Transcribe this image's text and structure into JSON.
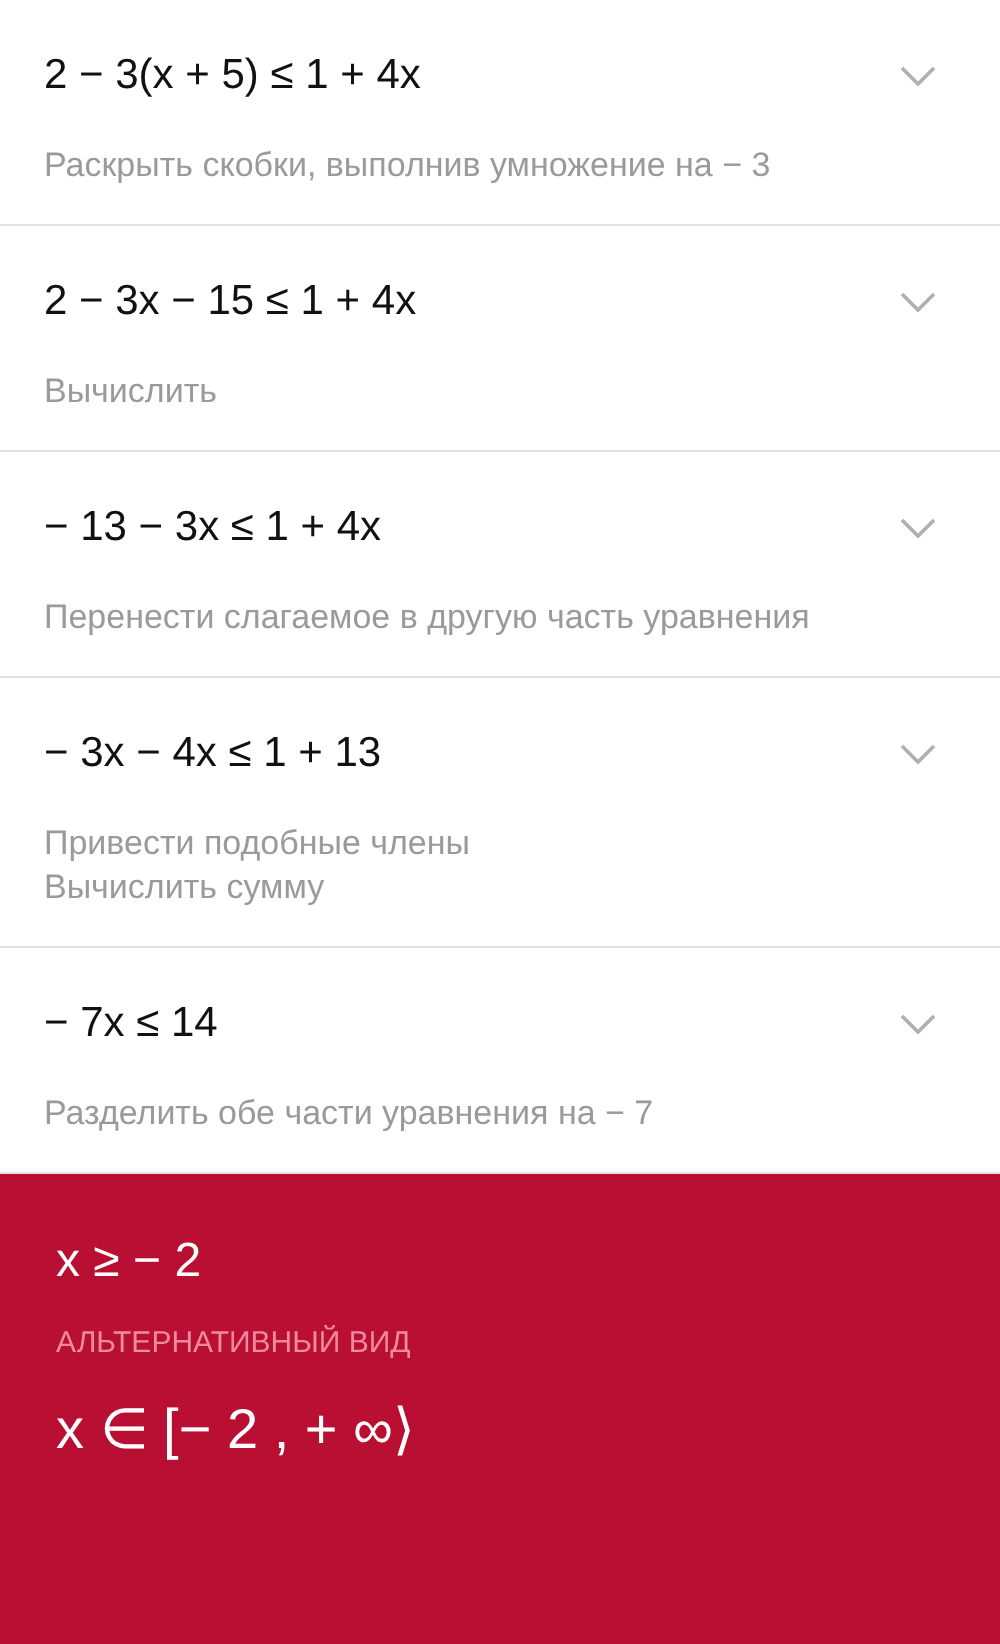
{
  "steps": [
    {
      "expression": "2 − 3(x + 5) ≤ 1 + 4x",
      "description": [
        "Раскрыть скобки, выполнив умножение на − 3"
      ]
    },
    {
      "expression": "2 − 3x − 15 ≤ 1 + 4x",
      "description": [
        "Вычислить"
      ]
    },
    {
      "expression": "− 13 − 3x ≤ 1 + 4x",
      "description": [
        "Перенести слагаемое в другую часть уравнения"
      ]
    },
    {
      "expression": "− 3x − 4x ≤ 1 + 13",
      "description": [
        "Привести подобные члены",
        "Вычислить сумму"
      ]
    },
    {
      "expression": "− 7x ≤ 14",
      "description": [
        "Разделить обе части уравнения на − 7"
      ]
    }
  ],
  "result": {
    "answer": "x ≥ − 2",
    "alternative_label": "АЛЬТЕРНАТИВНЫЙ ВИД",
    "alternative": "x ∈ [− 2 , + ∞⟩"
  }
}
